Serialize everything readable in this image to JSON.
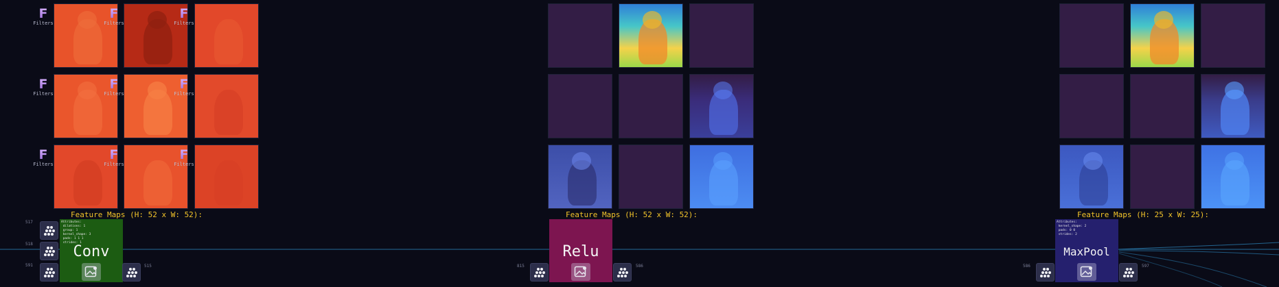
{
  "colors": {
    "background": "#0a0b17",
    "caption_text": "#f3c42a",
    "connector_line": "#2d8cc4",
    "conv_node": "#1c5c12",
    "relu_node": "#7d1550",
    "maxpool_node": "#25206e"
  },
  "conv": {
    "title": "Conv",
    "caption": "Feature Maps (H: 52 x W: 52):",
    "attributes": "Attributes:\n dilations: 1\n group: 1\n kernel_shape: 3\n pads: 1 1 1\n strides: 1",
    "filter_label": "Filters",
    "filter_glyph": "F",
    "port_labels": [
      "517",
      "518",
      "591",
      "515"
    ]
  },
  "relu": {
    "title": "Relu",
    "caption": "Feature Maps (H: 52 x W: 52):",
    "port_labels": [
      "815",
      "586"
    ]
  },
  "maxpool": {
    "title": "MaxPool",
    "caption": "Feature Maps (H: 25 x W: 25):",
    "attributes": "Attributes:\n kernel_shape: 2\n pads: 0 0\n strides: 2",
    "port_labels": [
      "586",
      "597"
    ]
  },
  "icons": {
    "port": "dots-grid-icon",
    "view_image": "image-icon"
  }
}
